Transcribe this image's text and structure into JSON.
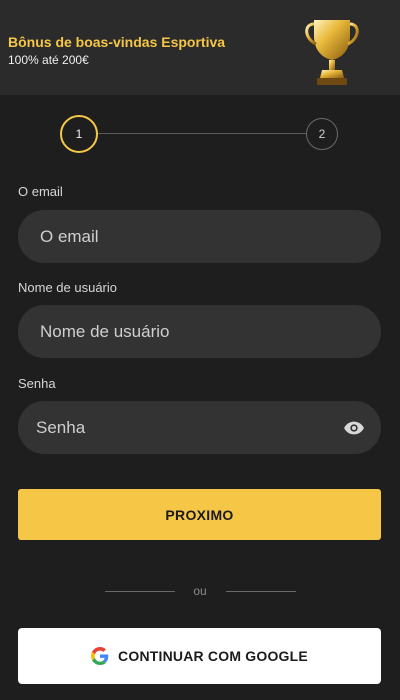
{
  "banner": {
    "title": "Bônus de boas-vindas Esportiva",
    "subtitle": "100% até 200€",
    "image": "trophy-icon"
  },
  "stepper": {
    "steps": [
      {
        "label": "1",
        "state": "active"
      },
      {
        "label": "2",
        "state": "inactive"
      }
    ]
  },
  "form": {
    "email": {
      "label": "O email",
      "placeholder": "O email",
      "value": ""
    },
    "username": {
      "label": "Nome de usuário",
      "placeholder": "Nome de usuário",
      "value": ""
    },
    "password": {
      "label": "Senha",
      "placeholder": "Senha",
      "value": "",
      "toggle_icon": "eye-icon"
    }
  },
  "actions": {
    "next_label": "PROXIMO",
    "divider_text": "ou",
    "google_label": "CONTINUAR COM GOOGLE",
    "google_icon": "google-icon"
  },
  "colors": {
    "accent": "#f6c646",
    "background": "#1e1e1e",
    "input_background": "#333333"
  }
}
